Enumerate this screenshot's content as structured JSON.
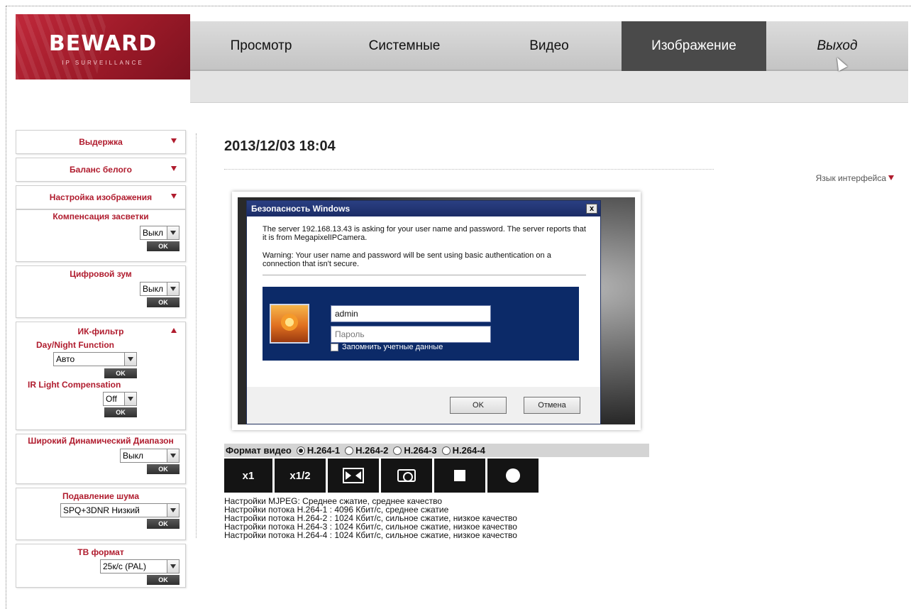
{
  "header": {
    "logo_text": "BEWARD",
    "logo_sub": "IP SURVEILLANCE",
    "nav": [
      {
        "label": "Просмотр"
      },
      {
        "label": "Системные"
      },
      {
        "label": "Видео"
      },
      {
        "label": "Изображение"
      },
      {
        "label": "Выход"
      }
    ]
  },
  "sidebar": {
    "exposure": "Выдержка",
    "white_balance": "Баланс белого",
    "image_settings": "Настройка изображения",
    "backlight": {
      "label": "Компенсация засветки",
      "value": "Выкл",
      "ok": "OK"
    },
    "digital_zoom": {
      "label": "Цифровой зум",
      "value": "Выкл",
      "ok": "OK"
    },
    "ir_filter": {
      "label": "ИК-фильтр",
      "day_night_label": "Day/Night Function",
      "day_night_value": "Авто",
      "ok1": "OK",
      "ir_comp_label": "IR Light Compensation",
      "ir_comp_value": "Off",
      "ok2": "OK"
    },
    "wdr": {
      "label": "Широкий Динамический Диапазон",
      "value": "Выкл",
      "ok": "OK"
    },
    "noise": {
      "label": "Подавление шума",
      "value": "SPQ+3DNR Низкий",
      "ok": "OK"
    },
    "tv_format": {
      "label": "ТВ формат",
      "value": "25к/с (PAL)",
      "ok": "OK"
    }
  },
  "main": {
    "datetime": "2013/12/03 18:04",
    "language": "Язык интерфейса"
  },
  "dialog": {
    "title": "Безопасность Windows",
    "close": "x",
    "message": "The server 192.168.13.43 is asking for your user name and password. The server reports that it is from MegapixelIPCamera.",
    "warning": "Warning: Your user name and password will be sent using basic authentication on a connection that isn't secure.",
    "username": "admin",
    "password_placeholder": "Пароль",
    "remember": "Запомнить учетные данные",
    "ok": "OK",
    "cancel": "Отмена"
  },
  "format": {
    "label": "Формат видео",
    "options": [
      "H.264-1",
      "H.264-2",
      "H.264-3",
      "H.264-4"
    ],
    "selected": "H.264-1"
  },
  "controls": {
    "x1": "x1",
    "x12": "x1/2"
  },
  "streams": [
    "Настройки MJPEG: Среднее сжатие, среднее качество",
    "Настройки потока H.264-1 : 4096 Кбит/с, среднее сжатие",
    "Настройки потока H.264-2 : 1024 Кбит/с, сильное сжатие, низкое качество",
    "Настройки потока H.264-3 : 1024 Кбит/с, сильное сжатие, низкое качество",
    "Настройки потока H.264-4 : 1024 Кбит/с, сильное сжатие, низкое качество"
  ],
  "colors": {
    "accent": "#b01c2e",
    "nav_active": "#4a4a4a",
    "dialog_title": "#1b2c66"
  }
}
